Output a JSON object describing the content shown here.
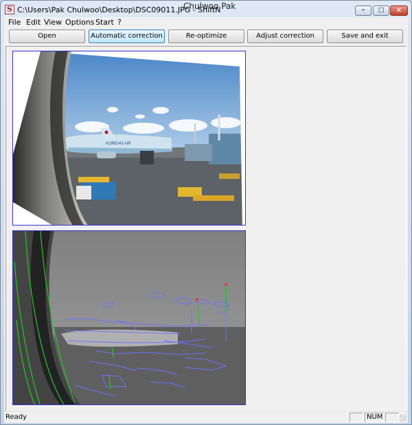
{
  "window": {
    "title": "C:\\Users\\Pak Chulwoo\\Desktop\\DSC09011.JPG - ShiftN",
    "overlay_name": "Chulwoo Pak",
    "icon_letter": "S",
    "controls": {
      "minimize": "–",
      "maximize": "□",
      "close": "✕"
    }
  },
  "menu": [
    "File",
    "Edit",
    "View",
    "Options",
    "Start",
    "?"
  ],
  "toolbar": {
    "open": "Open",
    "automatic_correction": "Automatic correction",
    "reoptimize": "Re-optimize",
    "adjust_correction": "Adjust correction",
    "save_and_exit": "Save and exit"
  },
  "images": {
    "top_alt": "corrected photo: Korean Air airplane seen through window",
    "bottom_alt": "edge-detection view with detected lines",
    "airline_text": "KOREAN AIR"
  },
  "status": {
    "text": "Ready",
    "num": "NUM"
  },
  "colors": {
    "panel_border": "#3030d0",
    "edge_lines": "#7070ff",
    "detected_lines": "#22cc22"
  }
}
